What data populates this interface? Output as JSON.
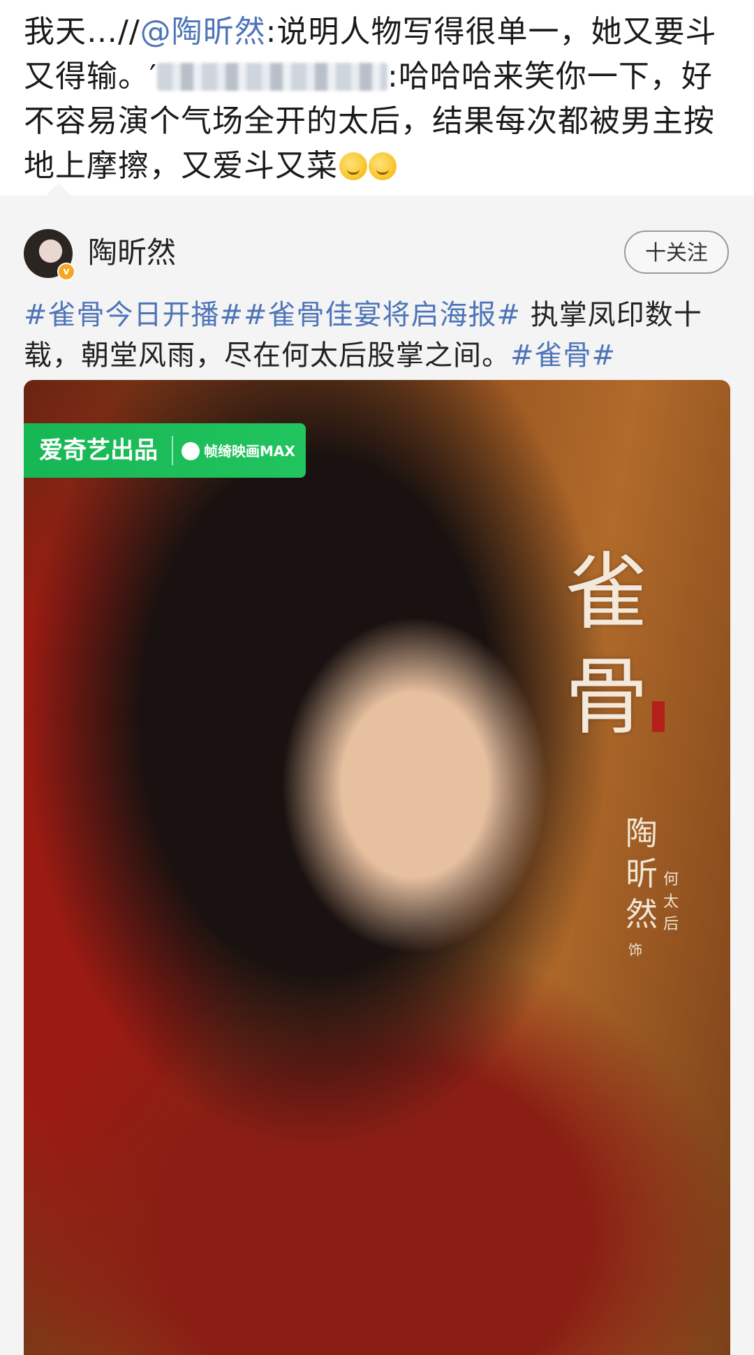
{
  "repost": {
    "prefix": "我天…//",
    "mention": "@陶昕然",
    "quote_1": ":说明人物写得很单一，她又要斗又得输。′",
    "quote_2": ":哈哈哈来笑你一下，好不容易演个气场全开的太后，结果每次都被男主按地上摩擦，又爱斗又菜"
  },
  "post": {
    "username": "陶昕然",
    "follow_label": "十关注",
    "tag_1": "#雀骨今日开播#",
    "tag_2": "#雀骨佳宴将启海报#",
    "body": " 执掌凤印数十载，朝堂风雨，尽在何太后股掌之间。",
    "tag_3": "#雀骨#"
  },
  "poster": {
    "brand_left": "爱奇艺出品",
    "brand_right": "帧绮映画MAX",
    "title_char_1": "雀",
    "title_char_2": "骨",
    "actor": "陶昕然",
    "role_prefix": "饰",
    "role": "何太后"
  },
  "colors": {
    "link": "#4e75b8",
    "brand_green": "#1bbd58",
    "badge": "#f5a623"
  }
}
